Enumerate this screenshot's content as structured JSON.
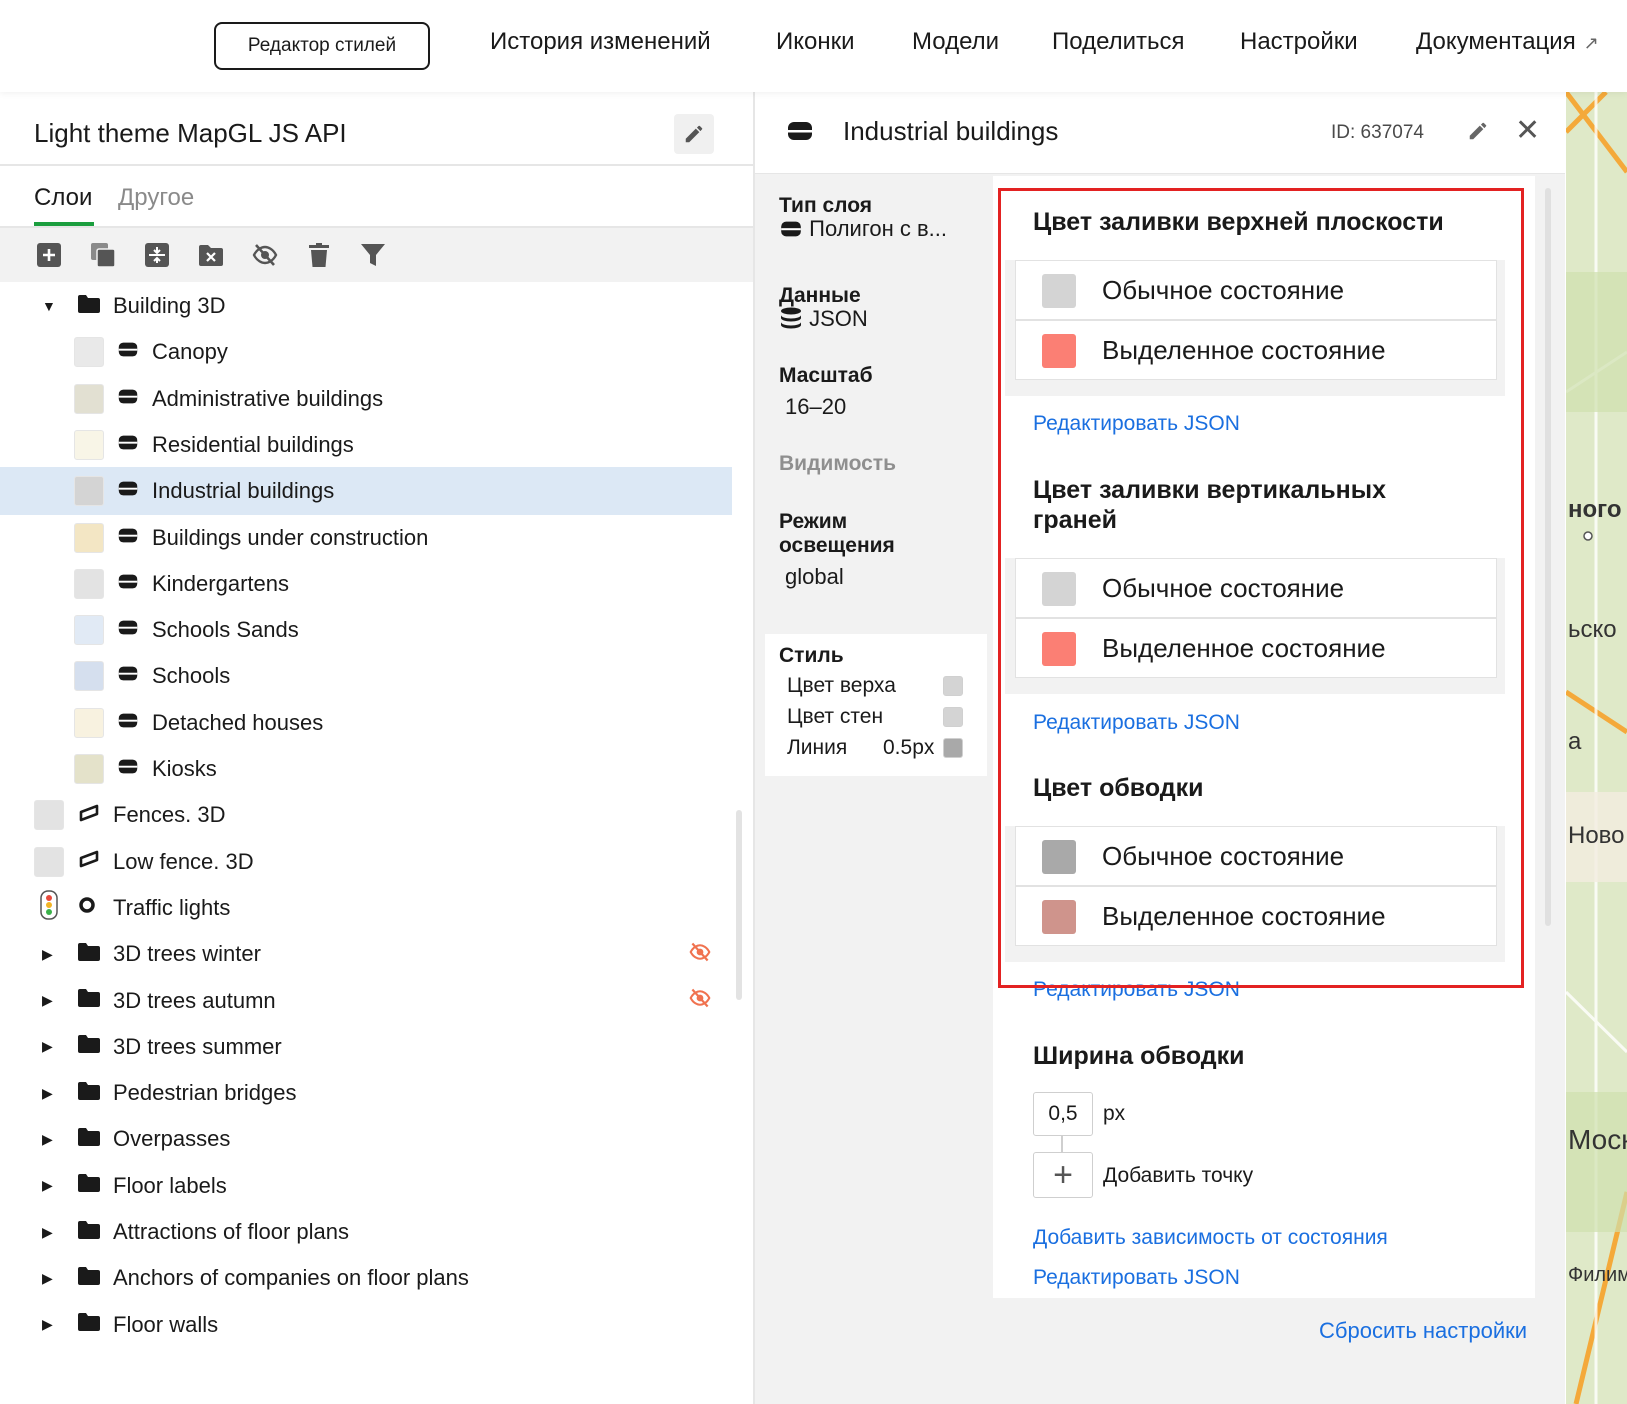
{
  "topnav": {
    "style_editor": "Редактор стилей",
    "links": [
      "История изменений",
      "Иконки",
      "Модели",
      "Поделиться",
      "Настройки",
      "Документация"
    ],
    "external_arrow": "↗"
  },
  "left": {
    "title": "Light theme MapGL JS API",
    "tabs": [
      "Слои",
      "Другое"
    ],
    "tree": [
      {
        "label": "Building 3D",
        "type": "folder",
        "caret": "▼"
      },
      {
        "label": "Canopy",
        "type": "polygon",
        "swatch": "#e9e9e9"
      },
      {
        "label": "Administrative buildings",
        "type": "polygon",
        "swatch": "#e2e0d2"
      },
      {
        "label": "Residential buildings",
        "type": "polygon",
        "swatch": "#f8f5e7"
      },
      {
        "label": "Industrial buildings",
        "type": "polygon",
        "swatch": "#d4d4d4",
        "selected": true
      },
      {
        "label": "Buildings under construction",
        "type": "polygon",
        "swatch": "#f3e6c4"
      },
      {
        "label": "Kindergartens",
        "type": "polygon",
        "swatch": "#e3e3e3"
      },
      {
        "label": "Schools Sands",
        "type": "polygon",
        "swatch": "#e1eaf5"
      },
      {
        "label": "Schools",
        "type": "polygon",
        "swatch": "#d5dfee"
      },
      {
        "label": "Detached houses",
        "type": "polygon",
        "swatch": "#f8f2e0"
      },
      {
        "label": "Kiosks",
        "type": "polygon",
        "swatch": "#e4e2ca"
      },
      {
        "label": "Fences. 3D",
        "type": "line"
      },
      {
        "label": "Low fence. 3D",
        "type": "line"
      },
      {
        "label": "Traffic lights",
        "type": "point"
      },
      {
        "label": "3D trees winter",
        "type": "folder",
        "caret": "▶",
        "hidden": true
      },
      {
        "label": "3D trees autumn",
        "type": "folder",
        "caret": "▶",
        "hidden": true
      },
      {
        "label": "3D trees summer",
        "type": "folder",
        "caret": "▶"
      },
      {
        "label": "Pedestrian bridges",
        "type": "folder",
        "caret": "▶"
      },
      {
        "label": "Overpasses",
        "type": "folder",
        "caret": "▶"
      },
      {
        "label": "Floor labels",
        "type": "folder",
        "caret": "▶"
      },
      {
        "label": "Attractions of floor plans",
        "type": "folder",
        "caret": "▶"
      },
      {
        "label": "Anchors of companies on floor plans",
        "type": "folder",
        "caret": "▶"
      },
      {
        "label": "Floor walls",
        "type": "folder",
        "caret": "▶"
      }
    ]
  },
  "right": {
    "title": "Industrial buildings",
    "id": "ID: 637074",
    "close": "✕",
    "meta": {
      "type_label": "Тип слоя",
      "type_value": "Полигон с в...",
      "data_label": "Данные",
      "data_value": "JSON",
      "scale_label": "Масштаб",
      "scale_value": "16–20",
      "visibility_label": "Видимость",
      "lighting_label_1": "Режим",
      "lighting_label_2": "освещения",
      "lighting_value": "global"
    },
    "style": {
      "title": "Стиль",
      "top": "Цвет верха",
      "walls": "Цвет стен",
      "line": "Линия",
      "line_px": "0.5px"
    },
    "sections": [
      {
        "title_1": "Цвет заливки верхней плоскости",
        "title_2": "",
        "normal": "Обычное состояние",
        "selected": "Выделенное состояние",
        "normal_color": "#d4d4d4",
        "selected_color": "#fb7f74"
      },
      {
        "title_1": "Цвет заливки вертикальных",
        "title_2": "граней",
        "normal": "Обычное состояние",
        "selected": "Выделенное состояние",
        "normal_color": "#d4d4d4",
        "selected_color": "#fb7f74"
      },
      {
        "title_1": "Цвет обводки",
        "title_2": "",
        "normal": "Обычное состояние",
        "selected": "Выделенное состояние",
        "normal_color": "#a9a9a9",
        "selected_color": "#cf948c"
      }
    ],
    "edit_json": "Редактировать JSON",
    "width_title": "Ширина обводки",
    "width_value": "0,5",
    "width_unit": "px",
    "add_plus": "+",
    "add_point": "Добавить точку",
    "add_state": "Добавить зависимость от состояния",
    "reset": "Сбросить настройки"
  },
  "map": {
    "labels": [
      "ного",
      "ьско",
      "а",
      "Ново",
      "Моск",
      "Филим"
    ]
  },
  "colors": {
    "accent": "#1b9e3e",
    "link": "#1a6fe0",
    "highlight": "#e32222",
    "selected_row": "#dce8f5",
    "hidden_icon": "#f0724f"
  }
}
